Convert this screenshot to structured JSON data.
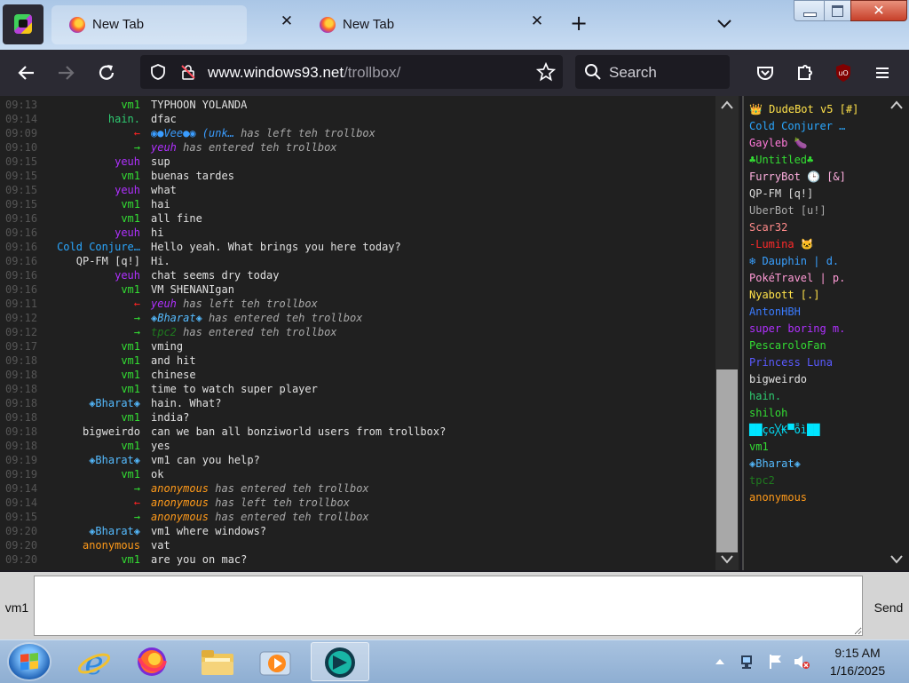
{
  "browser": {
    "tabs": [
      {
        "title": "New Tab"
      },
      {
        "title": "New Tab"
      }
    ],
    "url_host": "www.windows93.net",
    "url_path": "/trollbox/",
    "search_placeholder": "Search"
  },
  "colors": {
    "chat_bg": "#202020",
    "userlist_bg": "#202020",
    "taskbar": "#9bb8da",
    "tab_strip": "#bcd3ee"
  },
  "chat": {
    "messages": [
      {
        "time": "09:13",
        "nick": "vm1",
        "nick_color": "#33dd33",
        "text": "TYPHOON YOLANDA",
        "type": "msg"
      },
      {
        "time": "09:14",
        "nick": "hain.",
        "nick_color": "#2ecc71",
        "text": "dfac",
        "type": "msg"
      },
      {
        "time": "09:09",
        "nick": "←",
        "nick_color": "#ff2222",
        "text": "◉●Vee●◉ (unk… has left teh trollbox",
        "type": "left",
        "name_color": "#3a9dff"
      },
      {
        "time": "09:10",
        "nick": "→",
        "nick_color": "#33dd33",
        "text": "yeuh has entered teh trollbox",
        "type": "enter",
        "name_color": "#b030ff"
      },
      {
        "time": "09:15",
        "nick": "yeuh",
        "nick_color": "#b030ff",
        "text": "sup",
        "type": "msg"
      },
      {
        "time": "09:15",
        "nick": "vm1",
        "nick_color": "#33dd33",
        "text": "buenas tardes",
        "type": "msg"
      },
      {
        "time": "09:15",
        "nick": "yeuh",
        "nick_color": "#b030ff",
        "text": "what",
        "type": "msg"
      },
      {
        "time": "09:15",
        "nick": "vm1",
        "nick_color": "#33dd33",
        "text": "hai",
        "type": "msg"
      },
      {
        "time": "09:16",
        "nick": "vm1",
        "nick_color": "#33dd33",
        "text": "all fine",
        "type": "msg"
      },
      {
        "time": "09:16",
        "nick": "yeuh",
        "nick_color": "#b030ff",
        "text": "hi",
        "type": "msg"
      },
      {
        "time": "09:16",
        "nick": "Cold Conjure…",
        "nick_color": "#2aa7ff",
        "text": "Hello yeah. What brings you here today?",
        "type": "msg"
      },
      {
        "time": "09:16",
        "nick": "QP-FM [q!]",
        "nick_color": "#dddddd",
        "text": "Hi.",
        "type": "msg"
      },
      {
        "time": "09:16",
        "nick": "yeuh",
        "nick_color": "#b030ff",
        "text": "chat seems dry today",
        "type": "msg"
      },
      {
        "time": "09:16",
        "nick": "vm1",
        "nick_color": "#33dd33",
        "text": "VM SHENANIgan",
        "type": "msg"
      },
      {
        "time": "09:11",
        "nick": "←",
        "nick_color": "#ff2222",
        "text": "yeuh has left teh trollbox",
        "type": "left",
        "name_color": "#b030ff"
      },
      {
        "time": "09:12",
        "nick": "→",
        "nick_color": "#33dd33",
        "text": "◈Bharat◈ has entered teh trollbox",
        "type": "enter",
        "name_color": "#55bbff"
      },
      {
        "time": "09:12",
        "nick": "→",
        "nick_color": "#33dd33",
        "text": "tpc2 has entered teh trollbox",
        "type": "enter",
        "name_color": "#1f7a1f"
      },
      {
        "time": "09:17",
        "nick": "vm1",
        "nick_color": "#33dd33",
        "text": "vming",
        "type": "msg"
      },
      {
        "time": "09:18",
        "nick": "vm1",
        "nick_color": "#33dd33",
        "text": "and hit",
        "type": "msg"
      },
      {
        "time": "09:18",
        "nick": "vm1",
        "nick_color": "#33dd33",
        "text": "chinese",
        "type": "msg"
      },
      {
        "time": "09:18",
        "nick": "vm1",
        "nick_color": "#33dd33",
        "text": "time to watch super player",
        "type": "msg"
      },
      {
        "time": "09:18",
        "nick": "◈Bharat◈",
        "nick_color": "#55bbff",
        "text": "hain. What?",
        "type": "msg"
      },
      {
        "time": "09:18",
        "nick": "vm1",
        "nick_color": "#33dd33",
        "text": "india?",
        "type": "msg"
      },
      {
        "time": "09:18",
        "nick": "bigweirdo",
        "nick_color": "#e0e0e0",
        "text": "can we ban all bonziworld users from trollbox?",
        "type": "msg"
      },
      {
        "time": "09:18",
        "nick": "vm1",
        "nick_color": "#33dd33",
        "text": "yes",
        "type": "msg"
      },
      {
        "time": "09:19",
        "nick": "◈Bharat◈",
        "nick_color": "#55bbff",
        "text": "vm1 can you help?",
        "type": "msg"
      },
      {
        "time": "09:19",
        "nick": "vm1",
        "nick_color": "#33dd33",
        "text": "ok",
        "type": "msg"
      },
      {
        "time": "09:14",
        "nick": "→",
        "nick_color": "#33dd33",
        "text": "anonymous has entered teh trollbox",
        "type": "enter",
        "name_color": "#ff9a1a"
      },
      {
        "time": "09:14",
        "nick": "←",
        "nick_color": "#ff2222",
        "text": "anonymous has left teh trollbox",
        "type": "left",
        "name_color": "#ff9a1a"
      },
      {
        "time": "09:15",
        "nick": "→",
        "nick_color": "#33dd33",
        "text": "anonymous has entered teh trollbox",
        "type": "enter",
        "name_color": "#ff9a1a"
      },
      {
        "time": "09:20",
        "nick": "◈Bharat◈",
        "nick_color": "#55bbff",
        "text": "vm1 where windows?",
        "type": "msg"
      },
      {
        "time": "09:20",
        "nick": "anonymous",
        "nick_color": "#ff9a1a",
        "text": "vat",
        "type": "msg"
      },
      {
        "time": "09:20",
        "nick": "vm1",
        "nick_color": "#33dd33",
        "text": "are you on mac?",
        "type": "msg"
      }
    ]
  },
  "users": [
    {
      "name": "👑 DudeBot v5 [#]",
      "color": "#ffe24a"
    },
    {
      "name": "Cold Conjurer …",
      "color": "#2aa7ff"
    },
    {
      "name": "Gayleb 🍆",
      "color": "#ff7ad9"
    },
    {
      "name": "♣Untitled♣",
      "color": "#33dd33"
    },
    {
      "name": "FurryBot 🕒 [&]",
      "color": "#ffb0e0"
    },
    {
      "name": "QP-FM [q!]",
      "color": "#dddddd"
    },
    {
      "name": "UberBot [u!]",
      "color": "#aaaaaa"
    },
    {
      "name": "Scar32",
      "color": "#ff8a8a"
    },
    {
      "name": "-Lumina 🐱",
      "color": "#ff2a2a"
    },
    {
      "name": "❄ Dauphin | d.",
      "color": "#39a0ff"
    },
    {
      "name": "PokéTravel | p.",
      "color": "#ff9ad5"
    },
    {
      "name": "Nyabott [.]",
      "color": "#ffe24a"
    },
    {
      "name": "AntonHBH",
      "color": "#3a7bff"
    },
    {
      "name": "super boring m.",
      "color": "#b030ff"
    },
    {
      "name": "PescaroloFan",
      "color": "#33dd33"
    },
    {
      "name": "Princess Luna",
      "color": "#5a5aff"
    },
    {
      "name": "bigweirdo",
      "color": "#e0e0e0"
    },
    {
      "name": "hain.",
      "color": "#2ecc71"
    },
    {
      "name": "shiloh",
      "color": "#33dd33"
    },
    {
      "name": "██çɢ╳₭▀ȭì██",
      "color": "#00e5ff"
    },
    {
      "name": "vm1",
      "color": "#33dd33"
    },
    {
      "name": "◈Bharat◈",
      "color": "#55bbff"
    },
    {
      "name": "tpc2",
      "color": "#1f7a1f"
    },
    {
      "name": "anonymous",
      "color": "#ff9a1a"
    }
  ],
  "input": {
    "nick": "vm1",
    "value": "",
    "send_label": "Send"
  },
  "taskbar": {
    "time": "9:15 AM",
    "date": "1/16/2025"
  }
}
